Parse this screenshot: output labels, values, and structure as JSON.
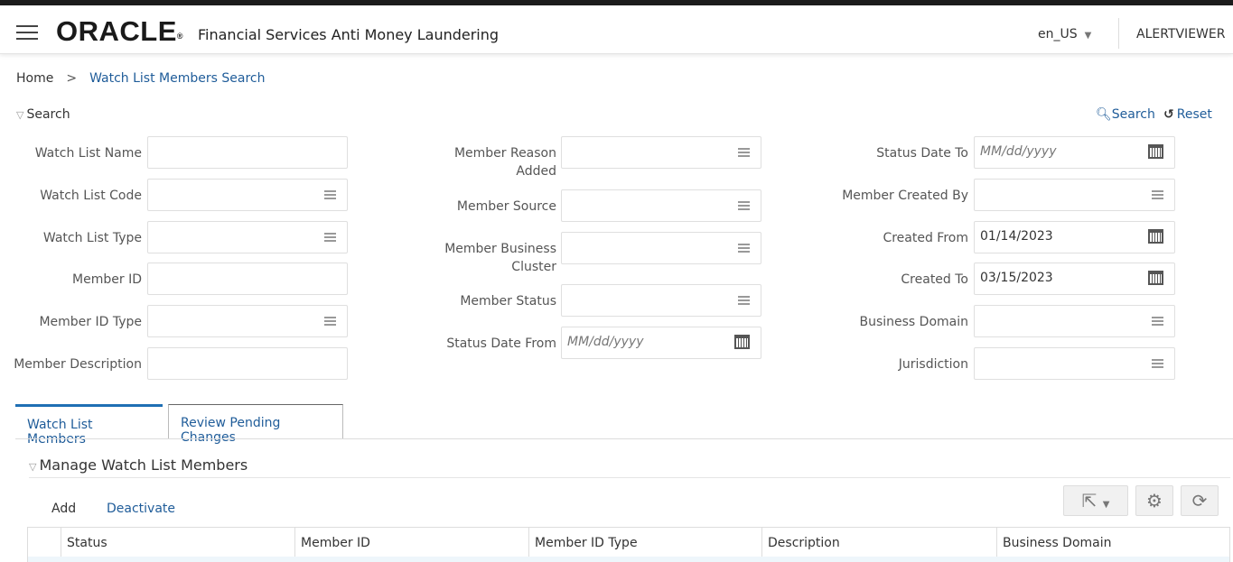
{
  "header": {
    "logo": "ORACLE",
    "logo_mark": "®",
    "app_name": "Financial Services Anti Money Laundering",
    "locale": "en_US",
    "user": "ALERTVIEWER"
  },
  "breadcrumb": {
    "home": "Home",
    "separator": ">",
    "current": "Watch List Members Search"
  },
  "search": {
    "title": "Search",
    "search_button": "Search",
    "reset_button": "Reset",
    "fields": {
      "watch_list_name": {
        "label": "Watch List Name",
        "value": ""
      },
      "watch_list_code": {
        "label": "Watch List Code",
        "value": ""
      },
      "watch_list_type": {
        "label": "Watch List Type",
        "value": ""
      },
      "member_id": {
        "label": "Member ID",
        "value": ""
      },
      "member_id_type": {
        "label": "Member ID Type",
        "value": ""
      },
      "member_description": {
        "label": "Member Description",
        "value": ""
      },
      "member_reason_added": {
        "label_line1": "Member Reason",
        "label_line2": "Added",
        "value": ""
      },
      "member_source": {
        "label": "Member Source",
        "value": ""
      },
      "member_business_cluster": {
        "label_line1": "Member Business",
        "label_line2": "Cluster",
        "value": ""
      },
      "member_status": {
        "label": "Member Status",
        "value": ""
      },
      "status_date_from": {
        "label": "Status Date From",
        "placeholder": "MM/dd/yyyy",
        "value": ""
      },
      "status_date_to": {
        "label": "Status Date To",
        "placeholder": "MM/dd/yyyy",
        "value": ""
      },
      "member_created_by": {
        "label": "Member Created By",
        "value": ""
      },
      "created_from": {
        "label": "Created From",
        "value": "01/14/2023"
      },
      "created_to": {
        "label": "Created To",
        "value": "03/15/2023"
      },
      "business_domain": {
        "label": "Business Domain",
        "value": ""
      },
      "jurisdiction": {
        "label": "Jurisdiction",
        "value": ""
      }
    }
  },
  "tabs": [
    {
      "label": "Watch List Members",
      "active": true
    },
    {
      "label": "Review Pending Changes",
      "active": false
    }
  ],
  "manage": {
    "title": "Manage Watch List Members",
    "actions": {
      "add": "Add",
      "deactivate": "Deactivate"
    },
    "toolbar_icons": [
      "export-icon",
      "settings-icon",
      "refresh-settings-icon"
    ],
    "columns": [
      "Status",
      "Member ID",
      "Member ID Type",
      "Description",
      "Business Domain"
    ]
  },
  "colors": {
    "link": "#1f5c99",
    "active_tab": "#1f6fb4",
    "header_bar": "#1c1c1c"
  }
}
